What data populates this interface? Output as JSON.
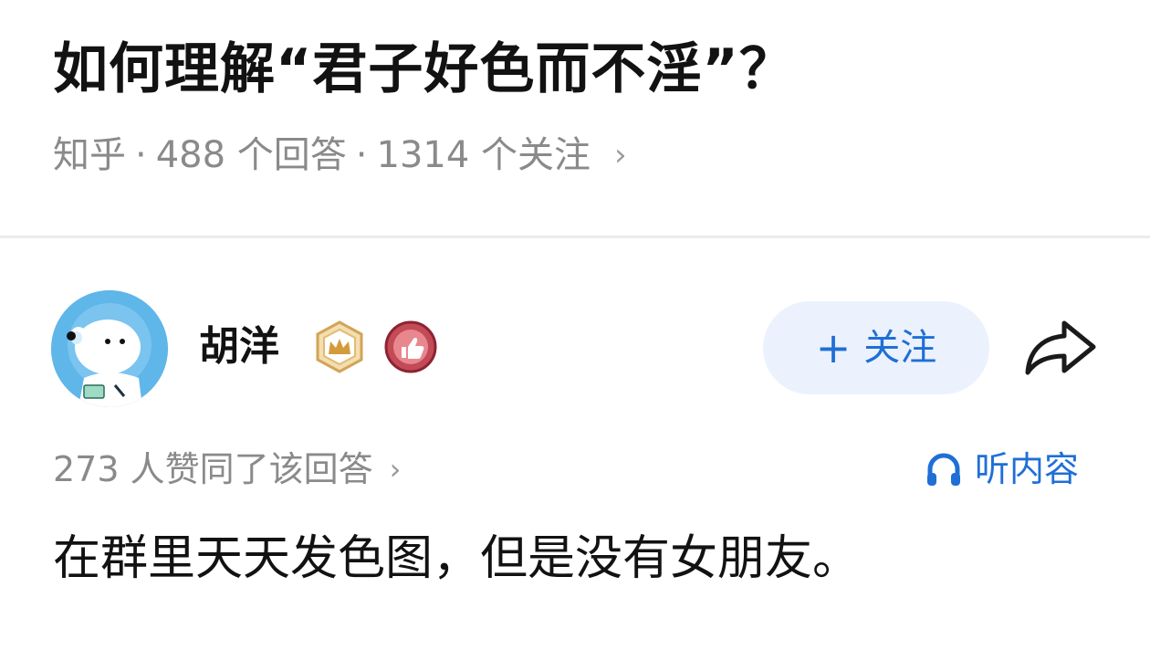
{
  "question": {
    "title": "如何理解“君子好色而不淫”？",
    "source": "知乎",
    "separator": "·",
    "answers": "488 个回答",
    "followers": "1314 个关注",
    "chevron": "›"
  },
  "author": {
    "name": "胡洋",
    "avatar": "polar-bear-astronaut-avatar",
    "badges": [
      "crown-badge-icon",
      "thumbs-up-badge-icon"
    ]
  },
  "actions": {
    "follow_plus": "+",
    "follow_label": "关注",
    "share_icon": "share-arrow-icon",
    "accent_color": "#1f6fd6",
    "follow_bg_color": "#ebf2fd"
  },
  "answer": {
    "votes": "273 人赞同了该回答",
    "votes_chevron": "›",
    "listen_icon": "headphones-icon",
    "listen_label": "听内容",
    "content": "在群里天天发色图，但是没有女朋友。"
  }
}
